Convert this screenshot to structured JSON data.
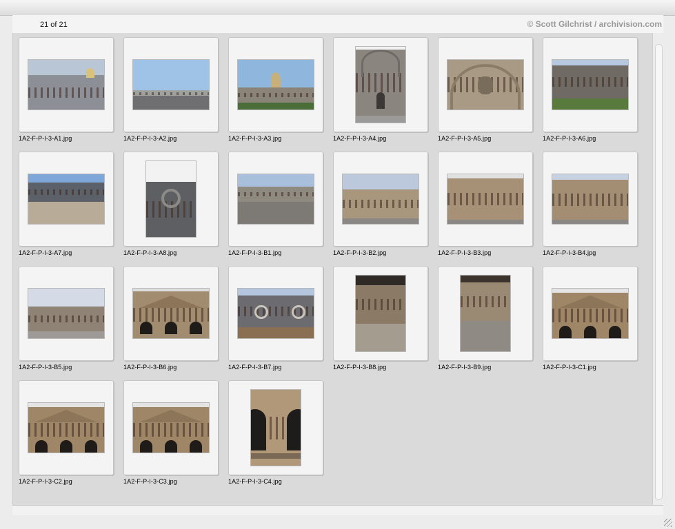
{
  "viewer": {
    "count_label": "21 of 21",
    "credit": "© Scott Gilchrist / archivision.com"
  },
  "slides": [
    {
      "filename": "1A2-F-P-I-3-A1.jpg",
      "thumb": "city-panorama-thumb"
    },
    {
      "filename": "1A2-F-P-I-3-A2.jpg",
      "thumb": "avenue-view-thumb"
    },
    {
      "filename": "1A2-F-P-I-3-A3.jpg",
      "thumb": "facade-dome-thumb"
    },
    {
      "filename": "1A2-F-P-I-3-A4.jpg",
      "thumb": "portal-arch-thumb"
    },
    {
      "filename": "1A2-F-P-I-3-A5.jpg",
      "thumb": "relief-tympanum-thumb"
    },
    {
      "filename": "1A2-F-P-I-3-A6.jpg",
      "thumb": "long-facade-thumb"
    },
    {
      "filename": "1A2-F-P-I-3-A7.jpg",
      "thumb": "dormer-roof-thumb"
    },
    {
      "filename": "1A2-F-P-I-3-A8.jpg",
      "thumb": "oculus-dormer-thumb"
    },
    {
      "filename": "1A2-F-P-I-3-B1.jpg",
      "thumb": "courtyard-wide-thumb"
    },
    {
      "filename": "1A2-F-P-I-3-B2.jpg",
      "thumb": "courtyard-arcade-thumb"
    },
    {
      "filename": "1A2-F-P-I-3-B3.jpg",
      "thumb": "courtyard-center-thumb"
    },
    {
      "filename": "1A2-F-P-I-3-B4.jpg",
      "thumb": "courtyard-corner-thumb"
    },
    {
      "filename": "1A2-F-P-I-3-B5.jpg",
      "thumb": "courtyard-far-thumb"
    },
    {
      "filename": "1A2-F-P-I-3-B6.jpg",
      "thumb": "pediment-facade-thumb"
    },
    {
      "filename": "1A2-F-P-I-3-B7.jpg",
      "thumb": "roof-dormers-thumb"
    },
    {
      "filename": "1A2-F-P-I-3-B8.jpg",
      "thumb": "gallery-corridor-thumb"
    },
    {
      "filename": "1A2-F-P-I-3-B9.jpg",
      "thumb": "gallery-hall-thumb"
    },
    {
      "filename": "1A2-F-P-I-3-C1.jpg",
      "thumb": "pediment-arches-thumb"
    },
    {
      "filename": "1A2-F-P-I-3-C2.jpg",
      "thumb": "pediment-arches-thumb"
    },
    {
      "filename": "1A2-F-P-I-3-C3.jpg",
      "thumb": "pediment-arches-thumb"
    },
    {
      "filename": "1A2-F-P-I-3-C4.jpg",
      "thumb": "arcade-detail-thumb"
    }
  ]
}
